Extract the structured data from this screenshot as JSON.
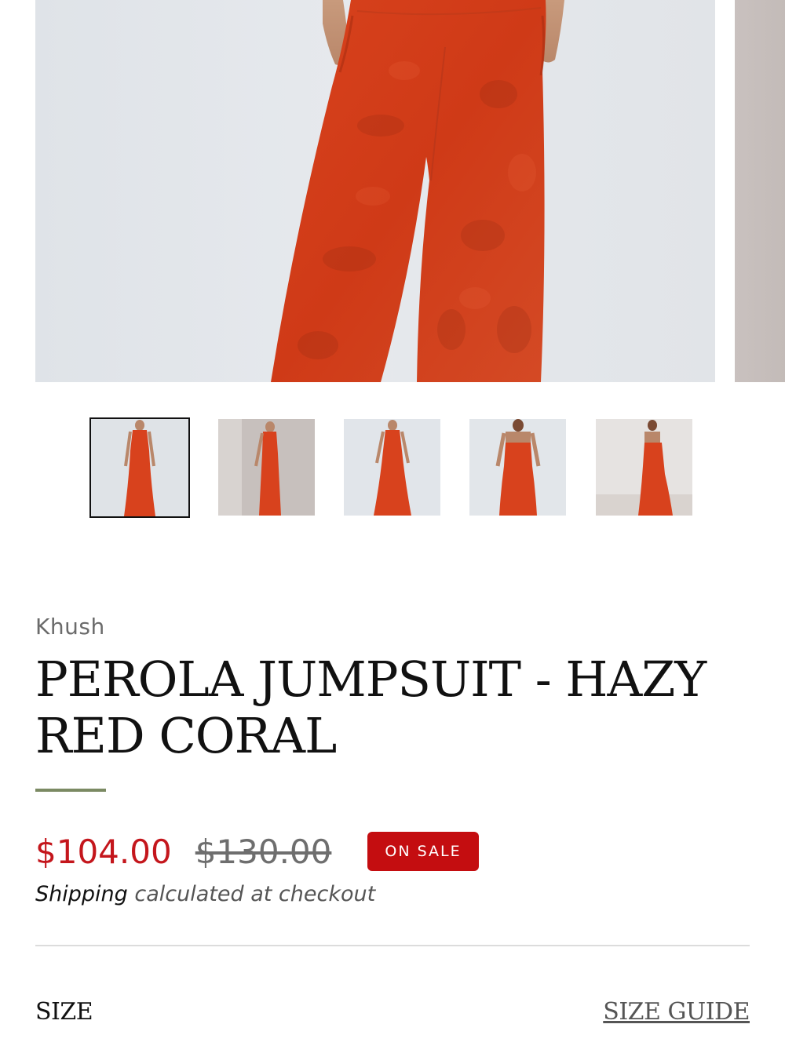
{
  "gallery": {
    "main_image_alt": "Red coral wide-leg jumpsuit, front view",
    "thumbnail_count": 5,
    "active_thumbnail": 1
  },
  "product": {
    "vendor": "Khush",
    "title": "PEROLA JUMPSUIT - HAZY RED CORAL",
    "price": "$104.00",
    "compare_price": "$130.00",
    "badge": "ON SALE",
    "shipping_link": "Shipping",
    "shipping_text": " calculated at checkout"
  },
  "options": {
    "size_label": "SIZE",
    "size_guide": "SIZE GUIDE"
  },
  "colors": {
    "sale_red": "#c4161c",
    "badge_red": "#c40d10",
    "accent_green": "#7b8a63",
    "garment_red": "#d9431f"
  },
  "icons": {
    "sale_badge": "tag"
  }
}
